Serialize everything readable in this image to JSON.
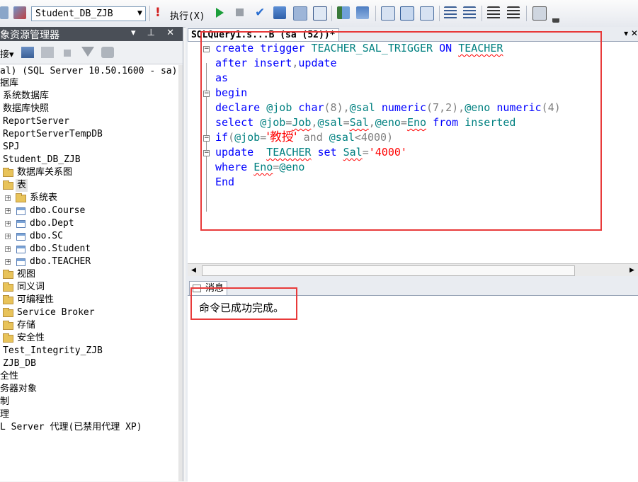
{
  "toolbar": {
    "database_selected": "Student_DB_ZJB",
    "execute_label": "执行(X)"
  },
  "explorer": {
    "title": "象资源管理器",
    "header_buttons": "▾ ⊥ ✕",
    "connect_label": "接▾",
    "tree": [
      {
        "text": "al) (SQL Server 10.50.1600 - sa)"
      },
      {
        "text": "据库"
      },
      {
        "text": "系统数据库"
      },
      {
        "text": "数据库快照"
      },
      {
        "text": "ReportServer"
      },
      {
        "text": "ReportServerTempDB"
      },
      {
        "text": "SPJ"
      },
      {
        "text": "Student_DB_ZJB"
      },
      {
        "text": "数据库关系图"
      },
      {
        "text": "表"
      },
      {
        "text": "系统表"
      },
      {
        "text": "dbo.Course"
      },
      {
        "text": "dbo.Dept"
      },
      {
        "text": "dbo.SC"
      },
      {
        "text": "dbo.Student"
      },
      {
        "text": "dbo.TEACHER"
      },
      {
        "text": "视图"
      },
      {
        "text": "同义词"
      },
      {
        "text": "可编程性"
      },
      {
        "text": "Service Broker"
      },
      {
        "text": "存储"
      },
      {
        "text": "安全性"
      },
      {
        "text": "Test_Integrity_ZJB"
      },
      {
        "text": "ZJB_DB"
      },
      {
        "text": "全性"
      },
      {
        "text": "务器对象"
      },
      {
        "text": "制"
      },
      {
        "text": "理"
      },
      {
        "text": "L Server 代理(已禁用代理 XP)"
      }
    ]
  },
  "editor": {
    "tab_title": "SQLQuery1.s...B (sa (52))*",
    "tab_controls": "▾ ✕",
    "code": {
      "l1": [
        "create",
        "trigger",
        "TEACHER_SAL_TRIGGER",
        "ON",
        "TEACHER"
      ],
      "l2": [
        "after",
        "insert",
        ",",
        "update"
      ],
      "l3": [
        "as"
      ],
      "l4": [
        "begin"
      ],
      "l5": [
        "declare",
        "@job",
        "char",
        "(8),",
        "@sal",
        "numeric",
        "(7,2),",
        "@eno",
        "numeric",
        "(4)"
      ],
      "l6": [
        "select",
        "@job",
        "=",
        "Job",
        ",",
        "@sal",
        "=",
        "Sal",
        ",",
        "@eno",
        "=",
        "Eno",
        "from",
        "inserted"
      ],
      "l7": [
        "if",
        "(",
        "@job",
        "=",
        "'教授'",
        "and",
        "@sal",
        "<4000)"
      ],
      "l8": [
        "update",
        "TEACHER",
        "set",
        "Sal",
        "=",
        "'4000'"
      ],
      "l9": [
        "where",
        "Eno",
        "=",
        "@eno"
      ],
      "l10": [
        "End"
      ]
    }
  },
  "messages": {
    "tab_label": "消息",
    "text": "命令已成功完成。"
  },
  "colors": {
    "keyword": "#0000ff",
    "function": "#ff00ff",
    "string": "#ff0000",
    "operator": "#808080",
    "identifier": "#008080",
    "annotation_box": "#e83a3a"
  }
}
